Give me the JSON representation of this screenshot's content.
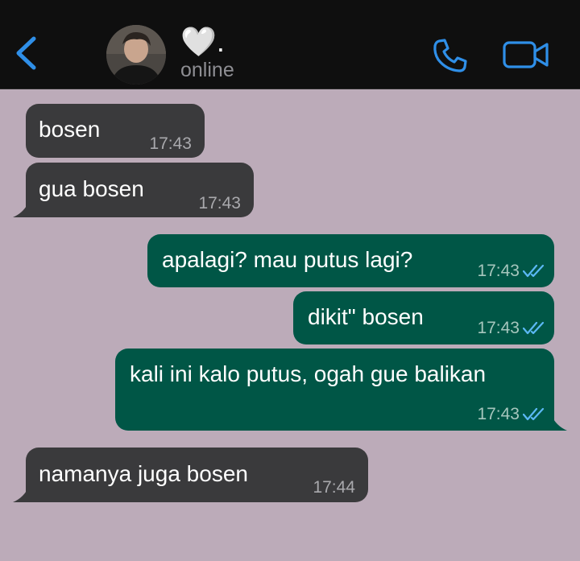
{
  "header": {
    "contact_name": "🤍.",
    "status": "online"
  },
  "messages": [
    {
      "text": "bosen",
      "time": "17:43"
    },
    {
      "text": "gua bosen",
      "time": "17:43"
    },
    {
      "text": "apalagi? mau putus lagi?",
      "time": "17:43"
    },
    {
      "text": "dikit\" bosen",
      "time": "17:43"
    },
    {
      "text": "kali ini kalo putus, ogah gue balikan",
      "time": "17:43"
    },
    {
      "text": "namanya juga bosen",
      "time": "17:44"
    }
  ],
  "colors": {
    "chat_background": "#bcabb9",
    "header_background": "#0f0f0f",
    "incoming_bubble": "#3a3a3c",
    "outgoing_bubble": "#005646",
    "accent_blue": "#2f8fe8",
    "read_ticks": "#5bb8f5"
  },
  "icons": {
    "back": "chevron-left-icon",
    "call": "phone-icon",
    "video": "video-camera-icon",
    "read_receipt": "double-check-icon"
  }
}
